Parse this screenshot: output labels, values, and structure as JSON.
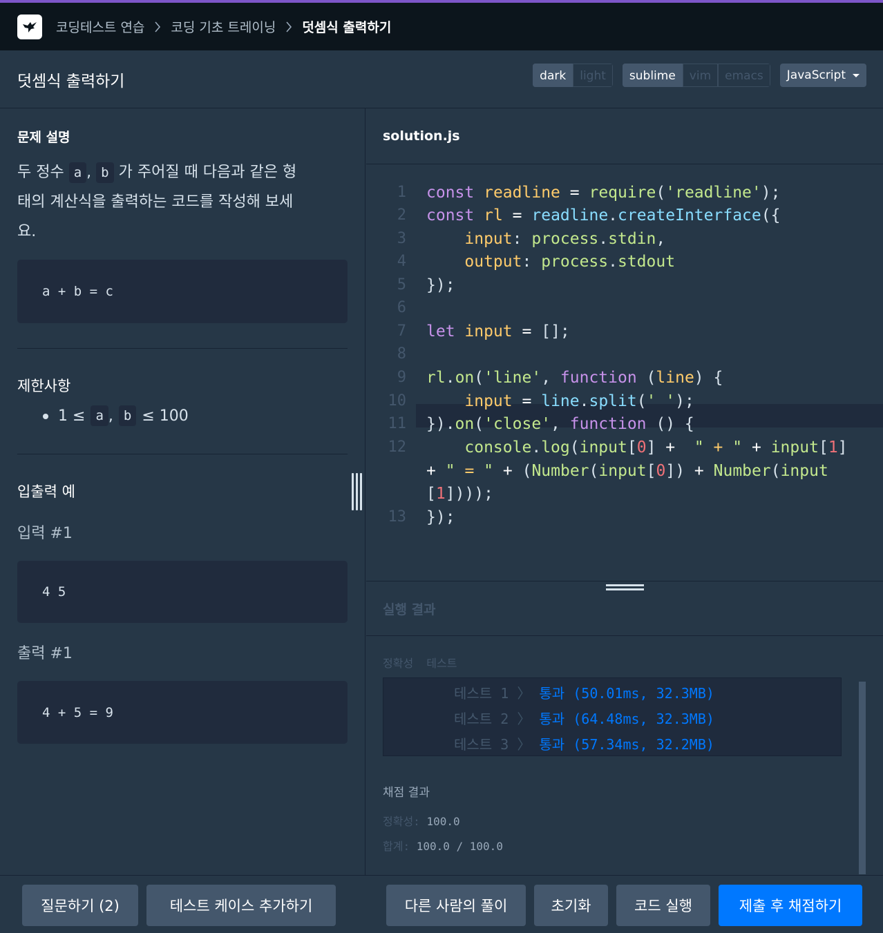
{
  "breadcrumb": [
    "코딩테스트 연습",
    "코딩 기초 트레이닝",
    "덧셈식 출력하기"
  ],
  "page_title": "덧셈식 출력하기",
  "theme_toggle": [
    "dark",
    "light"
  ],
  "keymap_toggle": [
    "sublime",
    "vim",
    "emacs"
  ],
  "language": "JavaScript",
  "problem": {
    "section_title": "문제 설명",
    "desc_before_a": "두 정수",
    "var_a": "a",
    "comma": ",",
    "var_b": "b",
    "desc_line1_tail": "가 주어질 때 다음과 같은 형",
    "desc_line2": "태의 계산식을 출력하는 코드를 작성해 보세",
    "desc_line3": "요.",
    "format_example": "a + b = c",
    "constraints_title": "제한사항",
    "constraint_prefix": "1 ≤",
    "constraint_suffix": "≤ 100",
    "io_title": "입출력 예",
    "input_label": "입력 #1",
    "input_value": "4 5",
    "output_label": "출력 #1",
    "output_value": "4 + 5 = 9"
  },
  "editor": {
    "filename": "solution.js",
    "line_numbers": [
      "1",
      "2",
      "3",
      "4",
      "5",
      "6",
      "7",
      "8",
      "9",
      "10",
      "11",
      "12",
      "13"
    ]
  },
  "results": {
    "header": "실행 결과",
    "tabs": [
      "정확성",
      "테스트"
    ],
    "rows": [
      {
        "label": "테스트 1",
        "arrow": "〉",
        "result": "통과 (50.01ms, 32.3MB)"
      },
      {
        "label": "테스트 2",
        "arrow": "〉",
        "result": "통과 (64.48ms, 32.3MB)"
      },
      {
        "label": "테스트 3",
        "arrow": "〉",
        "result": "통과 (57.34ms, 32.2MB)"
      }
    ],
    "score_title": "채점 결과",
    "accuracy_label": "정확성:",
    "accuracy_value": "100.0",
    "total_label": "합계:",
    "total_value": "100.0 / 100.0"
  },
  "footer": {
    "question": "질문하기 (2)",
    "add_testcase": "테스트 케이스 추가하기",
    "others": "다른 사람의 풀이",
    "reset": "초기화",
    "run": "코드 실행",
    "submit": "제출 후 채점하기"
  }
}
